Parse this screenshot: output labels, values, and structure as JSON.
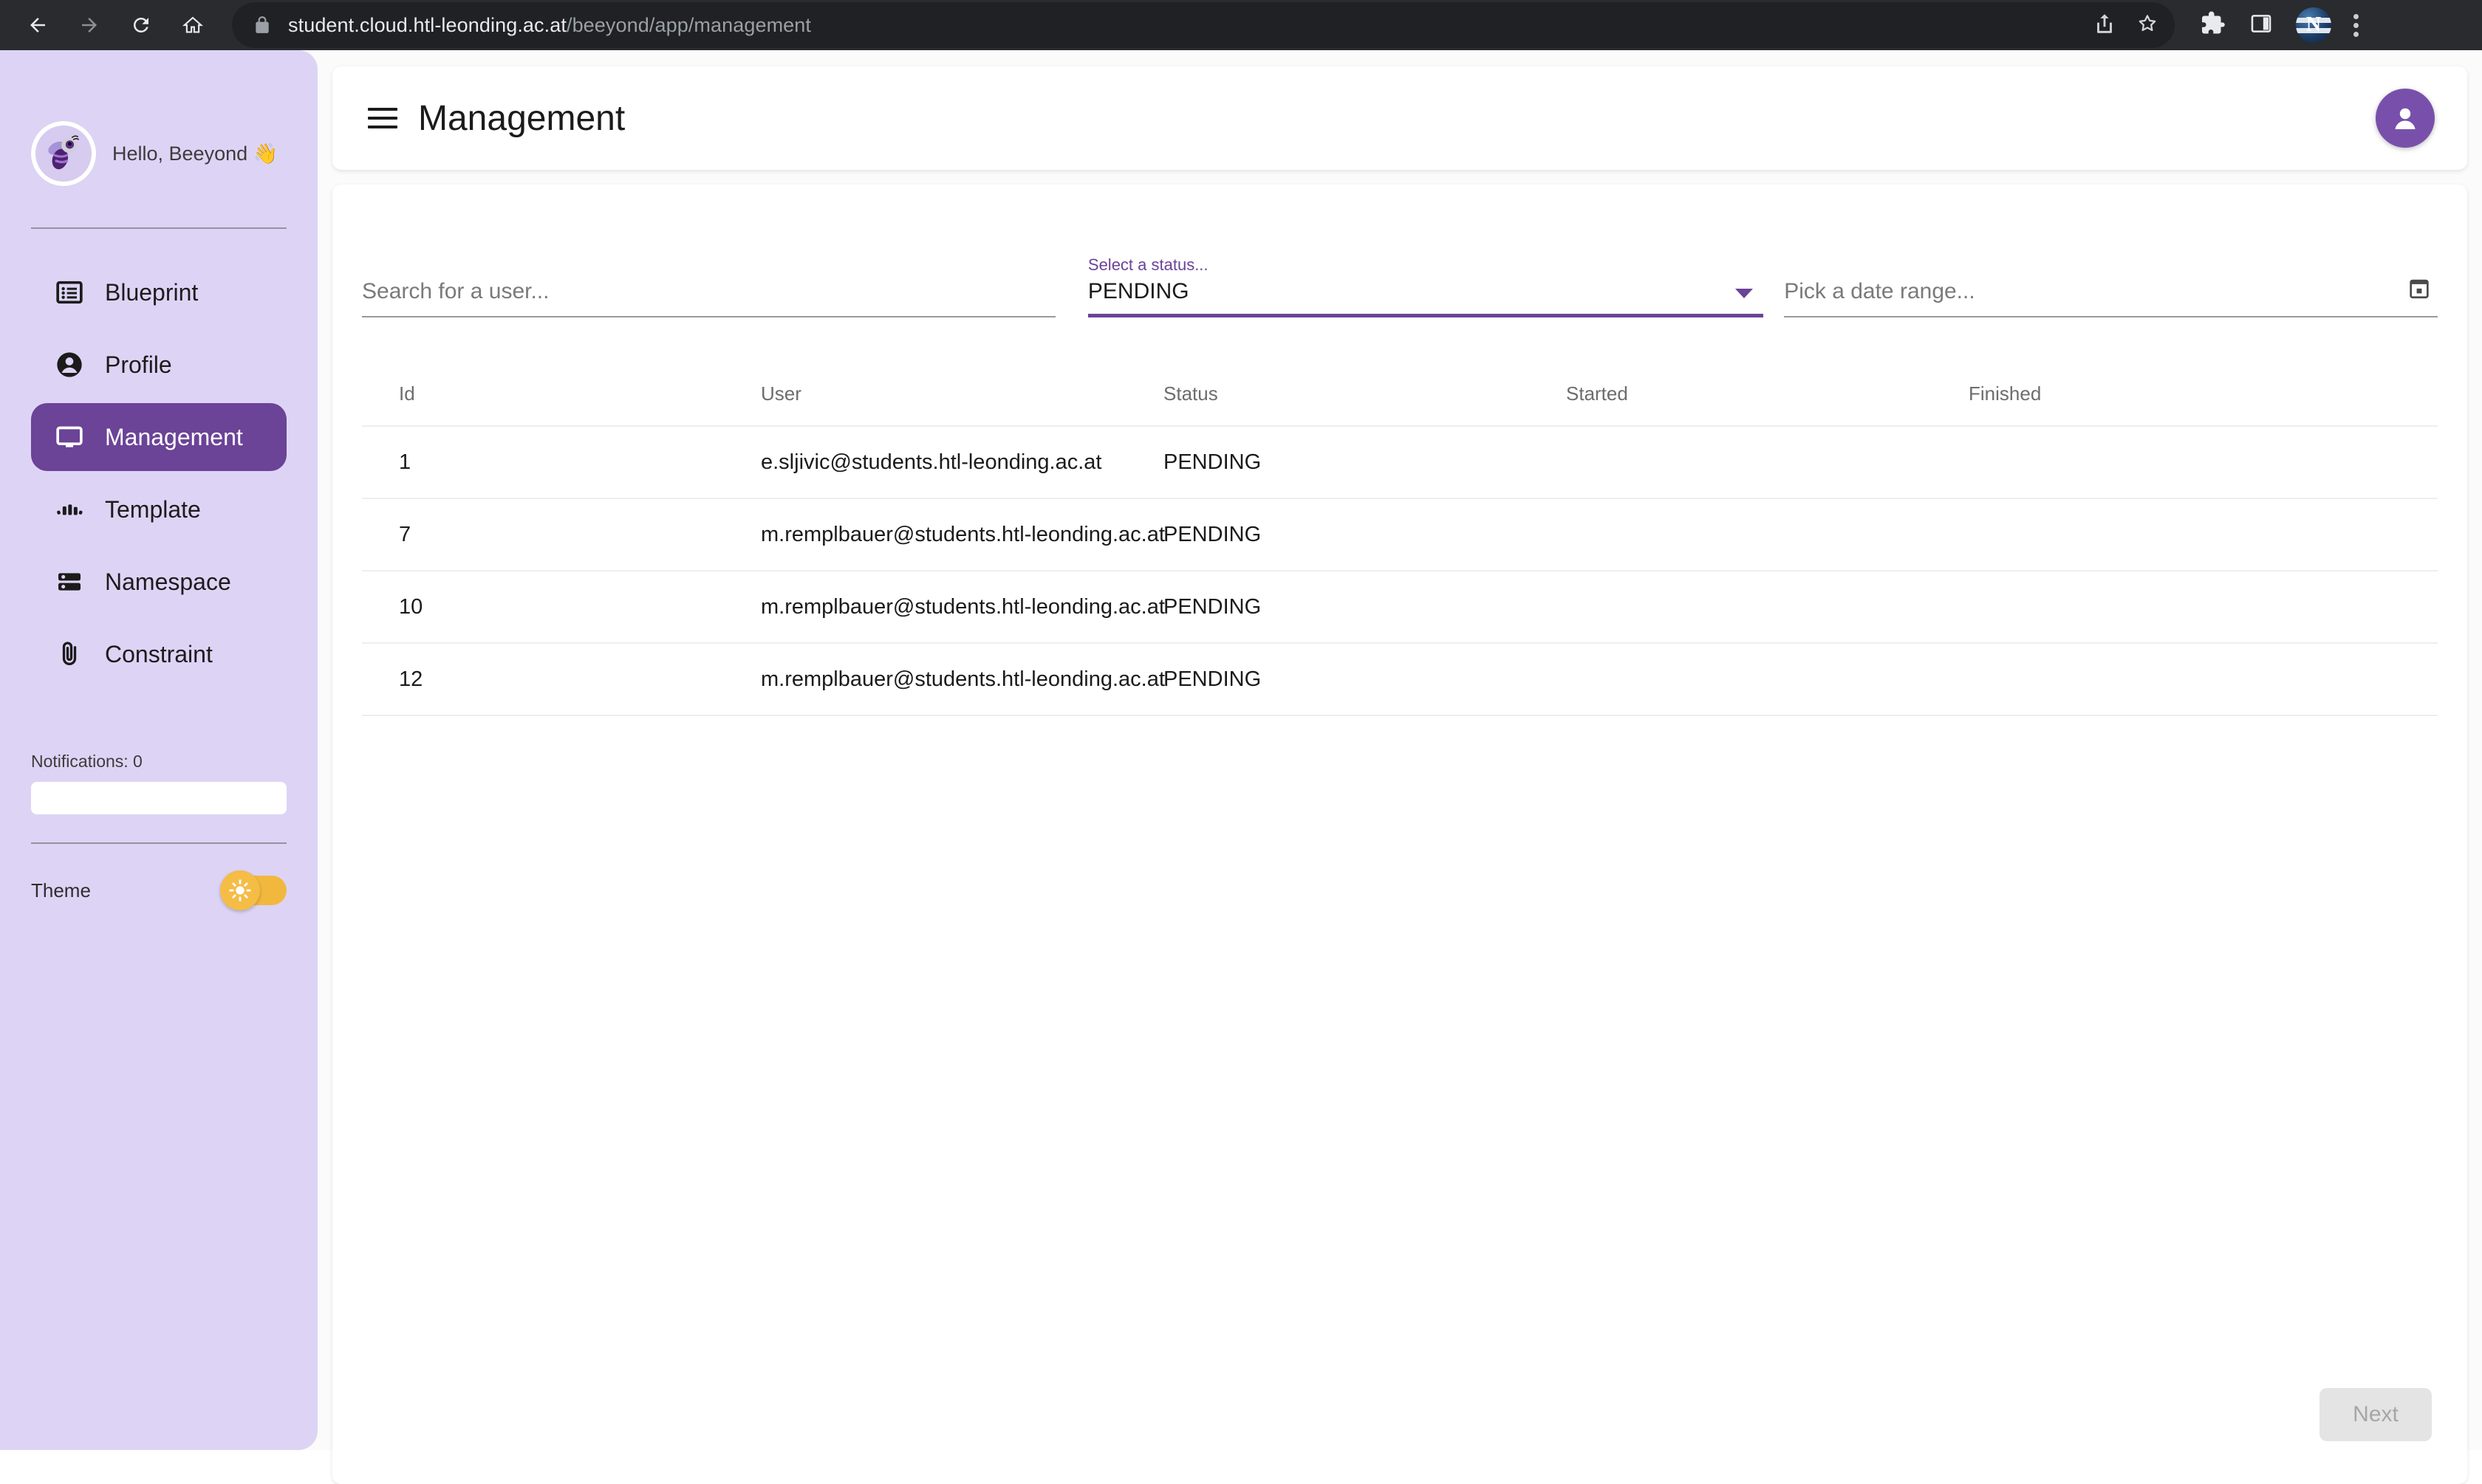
{
  "browser": {
    "back_icon": "back-arrow-icon",
    "forward_icon": "forward-arrow-icon",
    "reload_icon": "reload-icon",
    "home_icon": "home-icon",
    "lock_icon": "lock-icon",
    "url_domain": "student.cloud.htl-leonding.ac.at",
    "url_path": "/beeyond/app/management",
    "share_icon": "share-icon",
    "bookmark_icon": "star-icon",
    "extensions_icon": "puzzle-icon",
    "side_panel_icon": "side-panel-icon",
    "profile_avatar_letter": "N",
    "menu_icon": "three-dot-menu-icon"
  },
  "sidebar": {
    "greeting": "Hello, Beeyond 👋",
    "avatar_icon": "bee-logo-icon",
    "items": [
      {
        "label": "Blueprint",
        "icon": "list-icon",
        "active": false
      },
      {
        "label": "Profile",
        "icon": "person-icon",
        "active": false
      },
      {
        "label": "Management",
        "icon": "monitor-icon",
        "active": true
      },
      {
        "label": "Template",
        "icon": "bar-chart-icon",
        "active": false
      },
      {
        "label": "Namespace",
        "icon": "server-icon",
        "active": false
      },
      {
        "label": "Constraint",
        "icon": "paperclip-icon",
        "active": false
      }
    ],
    "notifications_label": "Notifications: 0",
    "notifications_value": "",
    "theme_label": "Theme",
    "theme_icon": "sun-icon",
    "theme_on": true,
    "accent_color": "#6b4397",
    "panel_color": "#ddd4f5",
    "toggle_color": "#f2b83e"
  },
  "header": {
    "menu_icon": "hamburger-icon",
    "title": "Management",
    "avatar_icon": "account-circle-icon"
  },
  "filters": {
    "search": {
      "placeholder": "Search for a user...",
      "value": ""
    },
    "status": {
      "label": "Select a status...",
      "value": "PENDING",
      "arrow_icon": "chevron-down-icon"
    },
    "date": {
      "placeholder": "Pick a date range...",
      "value": "",
      "icon": "calendar-icon"
    }
  },
  "table": {
    "columns": [
      "Id",
      "User",
      "Status",
      "Started",
      "Finished"
    ],
    "rows": [
      {
        "id": "1",
        "user": "e.sljivic@students.htl-leonding.ac.at",
        "status": "PENDING",
        "started": "",
        "finished": ""
      },
      {
        "id": "7",
        "user": "m.remplbauer@students.htl-leonding.ac.at",
        "status": "PENDING",
        "started": "",
        "finished": ""
      },
      {
        "id": "10",
        "user": "m.remplbauer@students.htl-leonding.ac.at",
        "status": "PENDING",
        "started": "",
        "finished": ""
      },
      {
        "id": "12",
        "user": "m.remplbauer@students.htl-leonding.ac.at",
        "status": "PENDING",
        "started": "",
        "finished": ""
      }
    ]
  },
  "pagination": {
    "next_label": "Next",
    "next_disabled": true
  }
}
